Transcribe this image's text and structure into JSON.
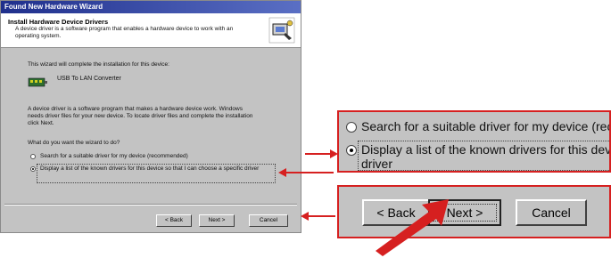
{
  "window": {
    "title": "Found New Hardware Wizard"
  },
  "header": {
    "title": "Install Hardware Device Drivers",
    "description": "A device driver is a software program that enables a hardware device to work with an operating system."
  },
  "body": {
    "intro": "This wizard will complete the installation for this device:",
    "device_name": "USB To LAN Converter",
    "explanation": "A device driver is a software program that makes a hardware device work. Windows needs driver files for your new device. To locate driver files and complete the installation click Next.",
    "question": "What do you want the wizard to do?"
  },
  "options": [
    {
      "label": "Search for a suitable driver for my device (recommended)",
      "selected": false
    },
    {
      "label": "Display a list of the known drivers for this device so that I can choose a specific driver",
      "selected": true
    }
  ],
  "buttons": {
    "back": "< Back",
    "next": "Next >",
    "cancel": "Cancel"
  },
  "zoom_options": {
    "first": "Search for a suitable driver for my device (recom",
    "second_line1": "Display a list of the known drivers for this device",
    "second_line2": "driver"
  },
  "zoom_buttons": {
    "back": "< Back",
    "next": "Next >",
    "cancel": "Cancel"
  },
  "colors": {
    "callout": "#d62020",
    "dialog_bg": "#c3c3c3",
    "titlebar": "#1f2f8c"
  },
  "icons": [
    "computer-hardware-icon",
    "network-device-icon",
    "radio-button-icon",
    "red-arrow-icon"
  ]
}
